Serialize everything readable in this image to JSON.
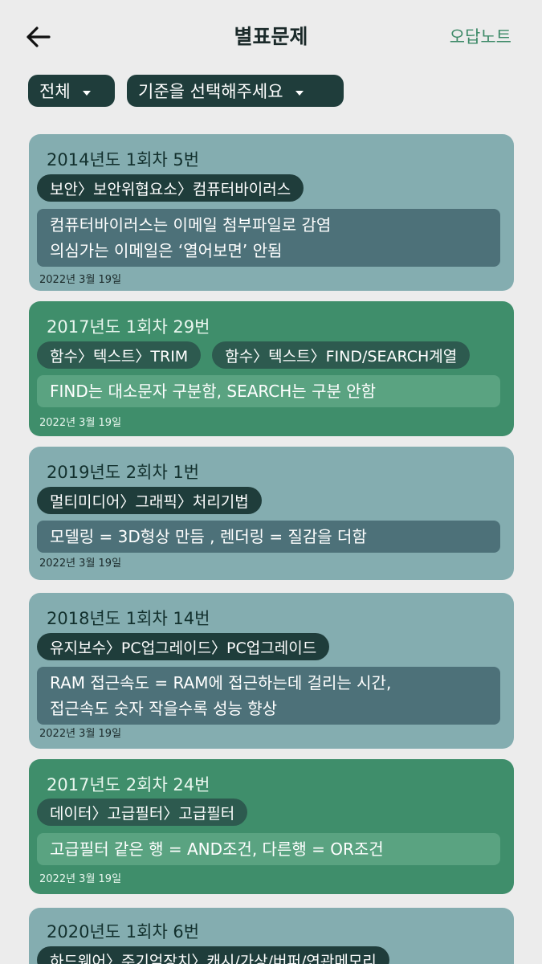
{
  "header": {
    "title": "별표문제",
    "right_link": "오답노트"
  },
  "filters": {
    "all_label": "전체",
    "criteria_label": "기준을 선택해주세요"
  },
  "cards": [
    {
      "title": "2014년도 1회차 5번",
      "tags": [
        "보안〉보안위협요소〉컴퓨터바이러스"
      ],
      "note_lines": [
        "컴퓨터바이러스는 이메일 첨부파일로 감염",
        "의심가는 이메일은 ‘열어보면’ 안됨"
      ],
      "date": "2022년 3월 19일"
    },
    {
      "title": "2017년도 1회차 29번",
      "tags": [
        "함수〉텍스트〉TRIM",
        "함수〉텍스트〉FIND/SEARCH계열"
      ],
      "note_lines": [
        "FIND는 대소문자 구분함, SEARCH는 구분 안함"
      ],
      "date": "2022년 3월 19일"
    },
    {
      "title": "2019년도 2회차 1번",
      "tags": [
        "멀티미디어〉그래픽〉처리기법"
      ],
      "note_lines": [
        "모델링 = 3D형상 만듬 , 렌더링 = 질감을 더함"
      ],
      "date": "2022년 3월 19일"
    },
    {
      "title": "2018년도 1회차 14번",
      "tags": [
        "유지보수〉PC업그레이드〉PC업그레이드"
      ],
      "note_lines": [
        "RAM 접근속도 = RAM에 접근하는데 걸리는 시간,",
        "접근속도 숫자 작을수록 성능 향상"
      ],
      "date": "2022년 3월 19일"
    },
    {
      "title": "2017년도 2회차 24번",
      "tags": [
        "데이터〉고급필터〉고급필터"
      ],
      "note_lines": [
        "고급필터 같은 행 = AND조건, 다른행 = OR조건"
      ],
      "date": "2022년 3월 19일"
    },
    {
      "title": "2020년도 1회차 6번",
      "tags": [
        "하드웨어〉주기억장치〉캐시/가상/버퍼/연관메모리"
      ],
      "note_lines": [],
      "date": ""
    }
  ],
  "colors": {
    "teal_card": "#84adb0",
    "green_card": "#3f8e6b",
    "dark_chip": "#1f3d3b",
    "accent_link": "#3e8a68"
  },
  "icons": {
    "back": "back-arrow-icon",
    "dropdown": "caret-down-icon"
  }
}
